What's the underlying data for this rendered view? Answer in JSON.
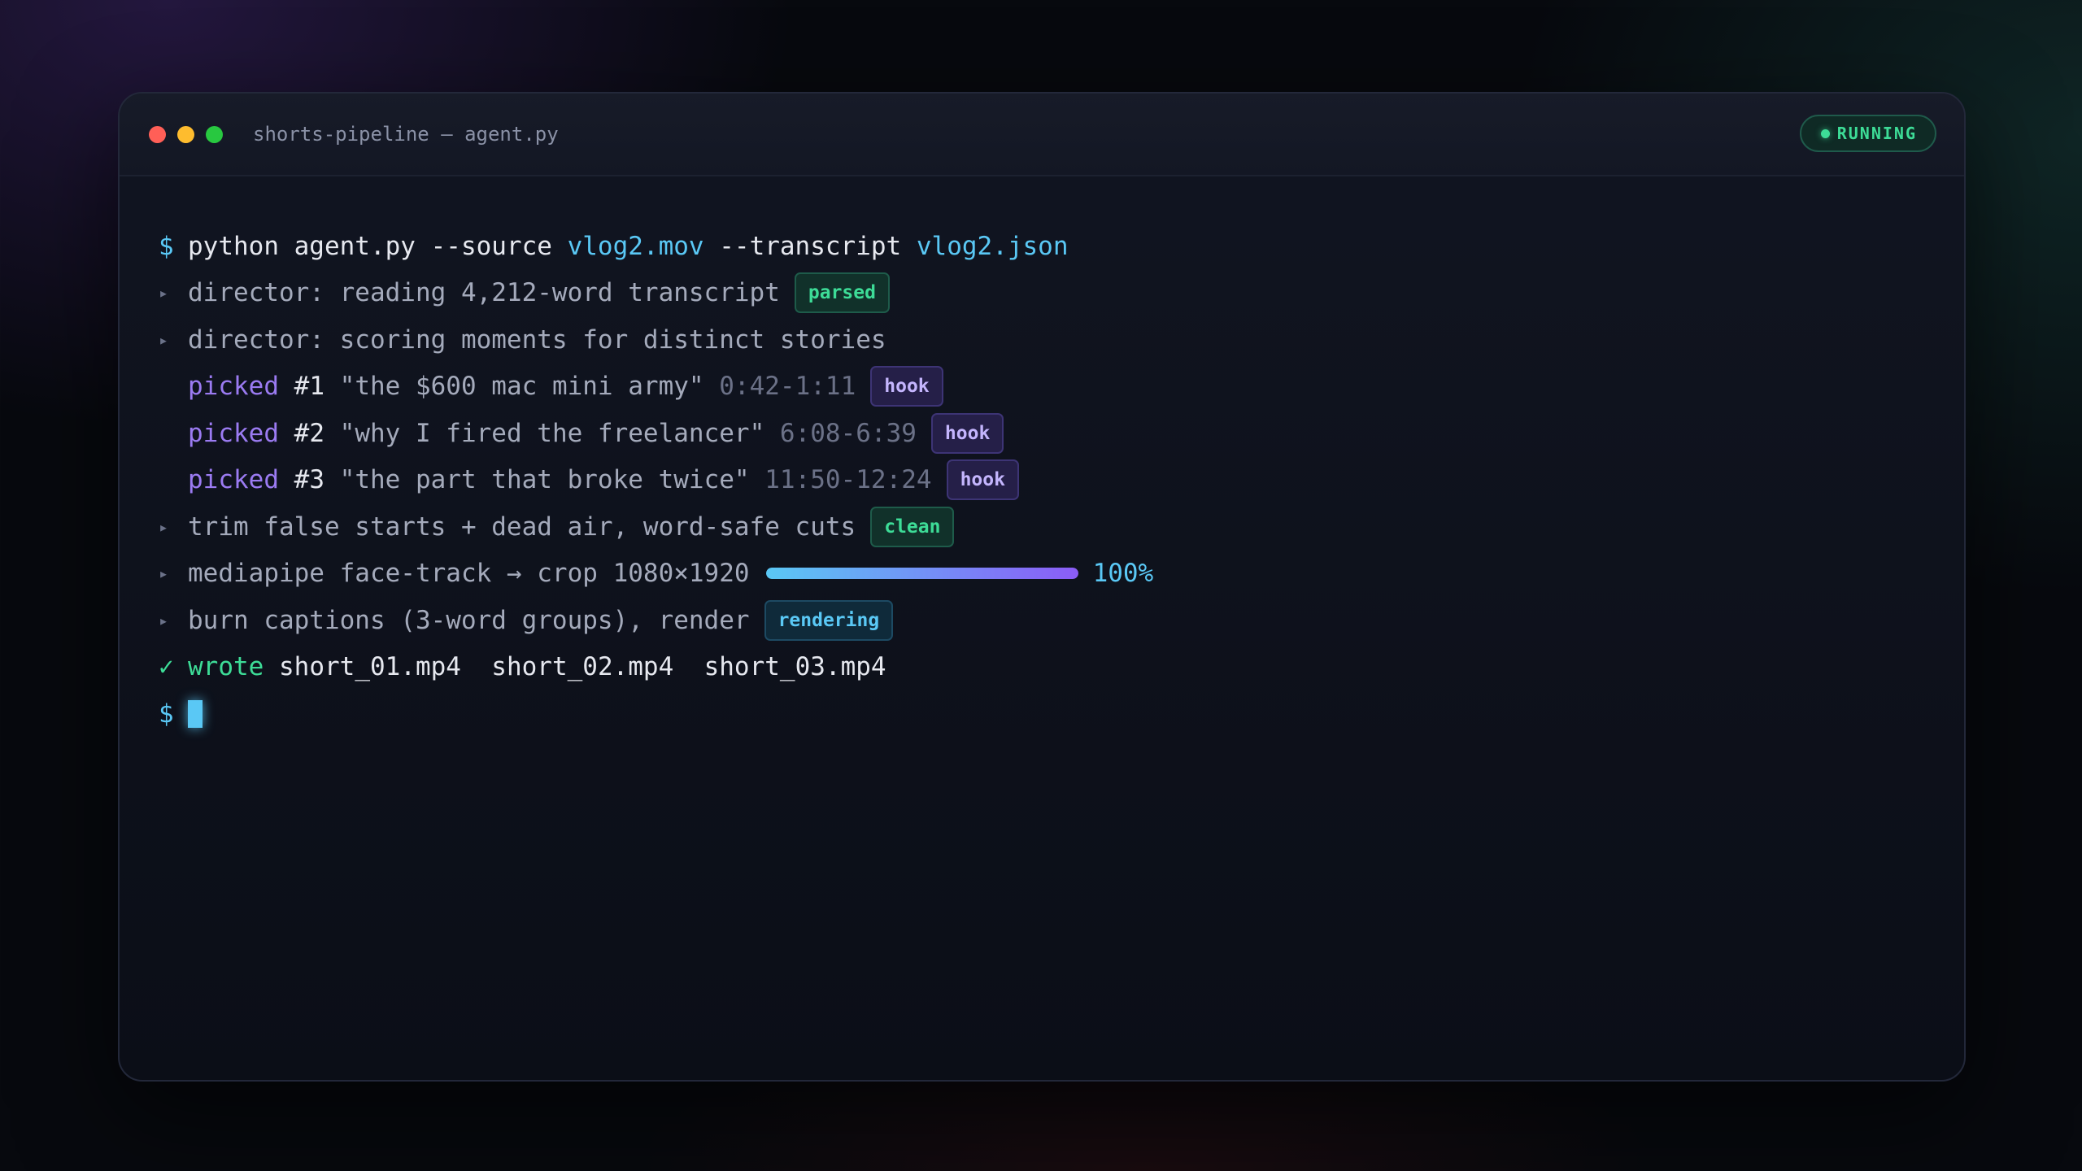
{
  "window": {
    "title": "shorts-pipeline — agent.py",
    "status": "RUNNING"
  },
  "colors": {
    "accent_cyan": "#5ac8f5",
    "accent_purple": "#9b7bf2",
    "success_green": "#3ddc97"
  },
  "terminal": {
    "prompt": "$",
    "arrow_glyph": "▸",
    "check_glyph": "✓",
    "command": {
      "program": "python agent.py --source ",
      "source_file": "vlog2.mov",
      "flag": " --transcript ",
      "transcript_file": "vlog2.json"
    },
    "steps": [
      {
        "text": "director: reading 4,212-word transcript",
        "tag": "parsed"
      },
      {
        "text": "director: scoring moments for distinct stories"
      }
    ],
    "picks": [
      {
        "label": "picked",
        "number": "#1",
        "title": "\"the $600 mac mini army\"",
        "range": "0:42-1:11",
        "tag": "hook"
      },
      {
        "label": "picked",
        "number": "#2",
        "title": "\"why I fired the freelancer\"",
        "range": "6:08-6:39",
        "tag": "hook"
      },
      {
        "label": "picked",
        "number": "#3",
        "title": "\"the part that broke twice\"",
        "range": "11:50-12:24",
        "tag": "hook"
      }
    ],
    "trim": {
      "text": "trim false starts + dead air, word-safe cuts",
      "tag": "clean"
    },
    "crop": {
      "text": "mediapipe face-track → crop 1080×1920",
      "progress": 1.0,
      "progress_label": "100%"
    },
    "captions": {
      "text": "burn captions (3-word groups), render",
      "tag": "rendering"
    },
    "result": {
      "label": "wrote",
      "files": [
        "short_01.mp4",
        "short_02.mp4",
        "short_03.mp4"
      ]
    }
  }
}
